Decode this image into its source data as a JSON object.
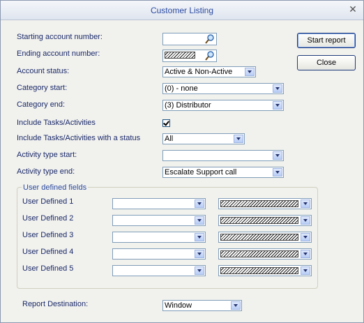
{
  "window": {
    "title": "Customer Listing"
  },
  "buttons": {
    "start": "Start report",
    "close": "Close"
  },
  "labels": {
    "starting_account": "Starting account number:",
    "ending_account": "Ending account number:",
    "account_status": "Account status:",
    "category_start": "Category start:",
    "category_end": "Category end:",
    "include_tasks": "Include Tasks/Activities",
    "include_tasks_status": "Include Tasks/Activities with a status",
    "activity_type_start": "Activity type start:",
    "activity_type_end": "Activity type end:",
    "report_destination": "Report Destination:"
  },
  "values": {
    "starting_account": "",
    "ending_account": "",
    "account_status": "Active & Non-Active",
    "category_start": "(0) - none",
    "category_end": "(3) Distributor",
    "include_tasks_checked": true,
    "include_tasks_status": "All",
    "activity_type_start": "",
    "activity_type_end": "Escalate Support call",
    "report_destination": "Window"
  },
  "user_defined": {
    "group_title": "User defined fields",
    "rows": [
      {
        "label": "User Defined 1",
        "value": ""
      },
      {
        "label": "User Defined 2",
        "value": ""
      },
      {
        "label": "User Defined 3",
        "value": ""
      },
      {
        "label": "User Defined 4",
        "value": ""
      },
      {
        "label": "User Defined 5",
        "value": ""
      }
    ]
  },
  "icons": {
    "close": "close-icon",
    "lookup": "magnifier-icon",
    "dropdown": "chevron-down-icon"
  }
}
